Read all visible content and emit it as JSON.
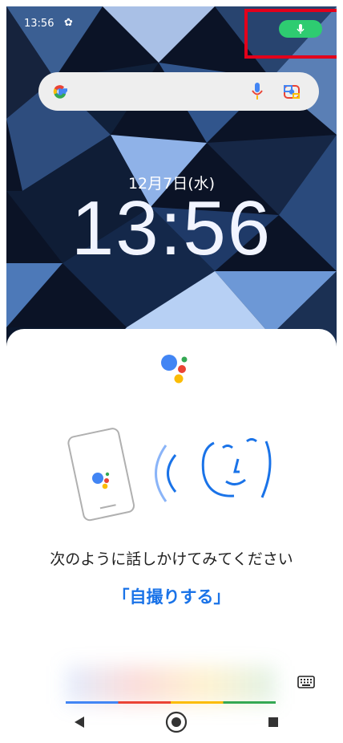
{
  "status_bar": {
    "time": "13:56",
    "settings_icon": "gear-icon",
    "mic_indicator_color": "#2ecc71"
  },
  "search_bar": {
    "logo": "google-g-icon",
    "mic_icon": "mic-icon",
    "lens_icon": "lens-icon"
  },
  "lockscreen": {
    "date": "12月7日(水)",
    "clock": "13:56"
  },
  "assistant": {
    "prompt": "次のように話しかけてみてください",
    "example": "「自撮りする」",
    "keyboard_icon": "keyboard-icon"
  },
  "nav": {
    "back": "back-triangle-icon",
    "home": "home-circle-icon",
    "recent": "recent-square-icon"
  },
  "colors": {
    "accent_blue": "#1a73e8",
    "google_blue": "#4285f4",
    "google_red": "#ea4335",
    "google_yellow": "#fbbc05",
    "google_green": "#34a853",
    "highlight_red": "#e3001b"
  }
}
